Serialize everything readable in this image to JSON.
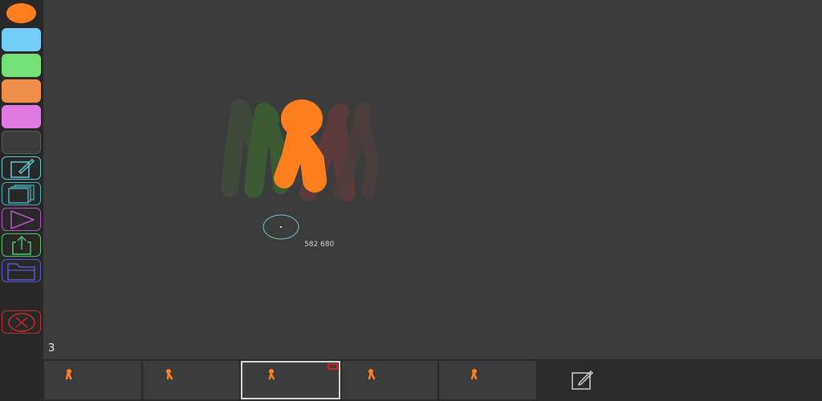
{
  "palette": {
    "current_color": "#ff7f1e",
    "swatches": [
      {
        "name": "blue-swatch",
        "color": "#73cdf7"
      },
      {
        "name": "green-swatch",
        "color": "#74e075"
      },
      {
        "name": "orange-swatch",
        "color": "#ef8e48"
      },
      {
        "name": "pink-swatch",
        "color": "#e07ae0"
      },
      {
        "name": "empty-swatch",
        "color": "#3c3c3c"
      }
    ]
  },
  "tools": [
    {
      "name": "edit-frame-button",
      "icon": "pencil-icon",
      "color": "#66c9d1"
    },
    {
      "name": "onion-skin-button",
      "icon": "layers-icon",
      "color": "#47aeb8"
    },
    {
      "name": "play-button",
      "icon": "play-icon",
      "color": "#b553c6"
    },
    {
      "name": "export-button",
      "icon": "share-icon",
      "color": "#53c36a"
    },
    {
      "name": "open-folder-button",
      "icon": "folder-icon",
      "color": "#5a57c9"
    },
    {
      "name": "close-button",
      "icon": "close-icon",
      "color": "#c0282d"
    }
  ],
  "canvas": {
    "frame_number": "3",
    "cursor_readout": "582 680"
  },
  "timeline": {
    "frames": [
      {
        "index": 1,
        "selected": false
      },
      {
        "index": 2,
        "selected": false
      },
      {
        "index": 3,
        "selected": true
      },
      {
        "index": 4,
        "selected": false
      },
      {
        "index": 5,
        "selected": false
      }
    ],
    "new_frame_icon": "pencil-icon"
  }
}
